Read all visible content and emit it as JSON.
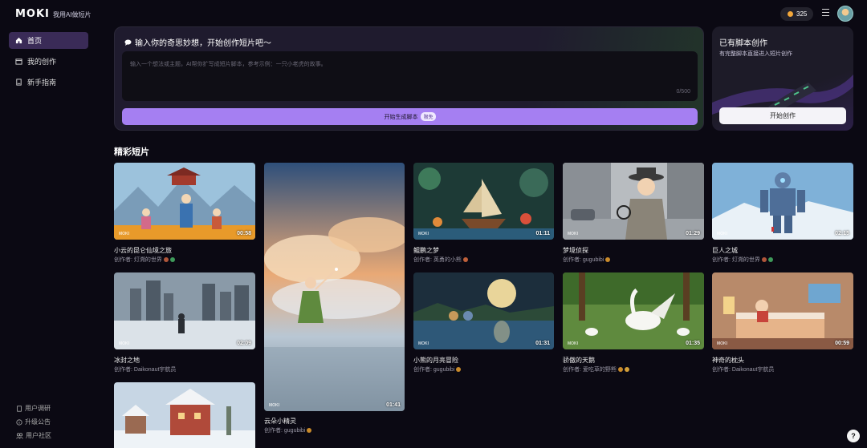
{
  "header": {
    "logo": "MOKI",
    "tagline": "我用AI做短片",
    "coins": "325"
  },
  "sidebar": {
    "items": [
      {
        "label": "首页",
        "icon": "home-icon"
      },
      {
        "label": "我的创作",
        "icon": "folder-icon"
      },
      {
        "label": "新手指南",
        "icon": "book-icon"
      }
    ],
    "bottom_links": [
      {
        "label": "用户调研",
        "icon": "survey-icon"
      },
      {
        "label": "升级公告",
        "icon": "info-icon"
      },
      {
        "label": "用户社区",
        "icon": "community-icon"
      }
    ]
  },
  "create": {
    "title": "输入你的奇思妙想，开始创作短片吧～",
    "placeholder": "输入一个想法或主题，AI帮你扩写成短片脚本，参考示例：一只小老虎的故事。",
    "char_count": "0/500",
    "button_label": "开始生成脚本",
    "badge": "限免"
  },
  "script_card": {
    "title": "已有脚本创作",
    "subtitle": "有完整脚本直接进入短片创作",
    "button_label": "开始创作"
  },
  "section": {
    "title": "精彩短片"
  },
  "watermark": "MOKI",
  "videos": [
    {
      "title": "小云的昆仑仙境之旅",
      "author": "创作者: 灯溯的世界",
      "duration": "00:58"
    },
    {
      "title": "云朵小精灵",
      "author": "创作者: gugubibi",
      "duration": "01:41"
    },
    {
      "title": "鲲鹏之梦",
      "author": "创作者: 英勇的小熊",
      "duration": "01:11"
    },
    {
      "title": "梦境侦探",
      "author": "创作者: gugubibi",
      "duration": "01:29"
    },
    {
      "title": "巨人之城",
      "author": "创作者: 灯溯的世界",
      "duration": "02:15"
    },
    {
      "title": "冰封之地",
      "author": "创作者: Daikonaut宇航员",
      "duration": "02:09"
    },
    {
      "title": "小熊的月亮冒险",
      "author": "创作者: gugubibi",
      "duration": "01:31"
    },
    {
      "title": "骄傲的天鹅",
      "author": "创作者: 爱吃草的野熊",
      "duration": "01:35"
    },
    {
      "title": "神奇的枕头",
      "author": "创作者: Daikonaut宇航员",
      "duration": "00:59"
    },
    {
      "title": "",
      "author": "",
      "duration": ""
    }
  ],
  "help_label": "?"
}
